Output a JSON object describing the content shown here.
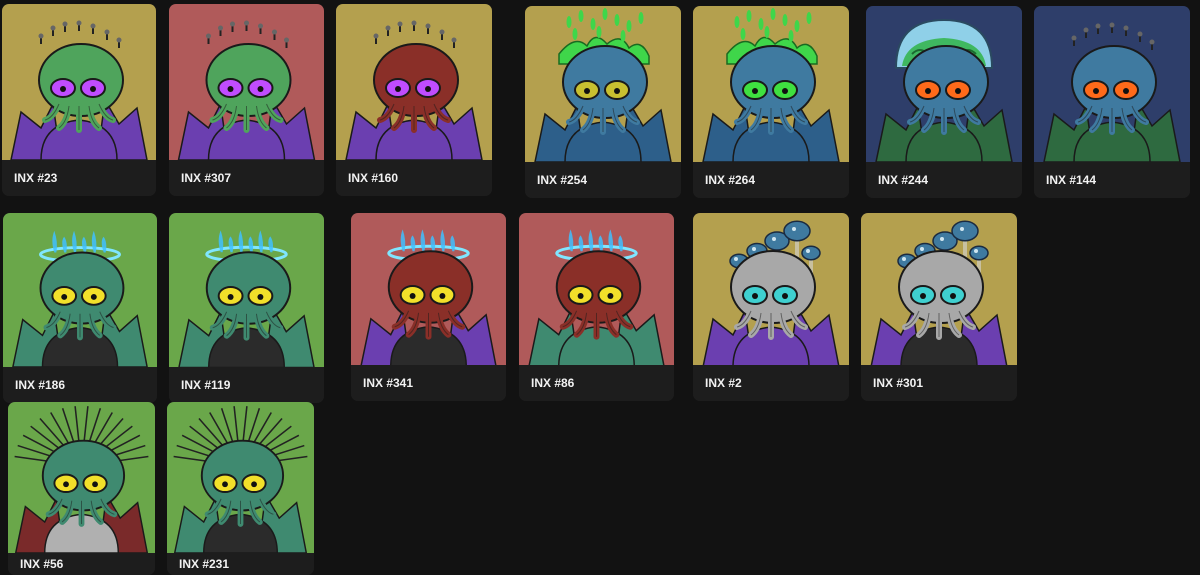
{
  "colors": {
    "page_background": "#121212",
    "caption_background": "#1d1d1d",
    "caption_text": "#f2f2f2",
    "bg_gold": "#b4a04e",
    "bg_red": "#b05a5a",
    "bg_green": "#6aa74a",
    "bg_blue": "#2e3e6a"
  },
  "gallery": {
    "items": [
      {
        "label": "INX #23",
        "background": "gold",
        "skin": "#4fa45c",
        "eyes": "#c04cff",
        "tentacles": "#4fa45c",
        "body": "#6b3fb0",
        "headwear": "spikes",
        "wings": "#6b3fb0"
      },
      {
        "label": "INX #307",
        "background": "red",
        "skin": "#4fa45c",
        "eyes": "#c04cff",
        "tentacles": "#4fa45c",
        "body": "#6b3fb0",
        "headwear": "spikes",
        "wings": "#6b3fb0"
      },
      {
        "label": "INX #160",
        "background": "gold",
        "skin": "#8a2f28",
        "eyes": "#c04cff",
        "tentacles": "#8a2f28",
        "body": "#6b3fb0",
        "headwear": "spikes",
        "wings": "#6b3fb0"
      },
      {
        "label": "INX #254",
        "background": "gold",
        "skin": "#3f7aa0",
        "eyes": "#c8c030",
        "tentacles": "#3f7aa0",
        "body": "#2d5f8a",
        "headwear": "slime",
        "wings": "#2d5f8a"
      },
      {
        "label": "INX #264",
        "background": "gold",
        "skin": "#3f7aa0",
        "eyes": "#3fe040",
        "tentacles": "#3f7aa0",
        "body": "#2d5f8a",
        "headwear": "slime",
        "wings": "#2d5f8a"
      },
      {
        "label": "INX #244",
        "background": "blue",
        "skin": "#3f7aa0",
        "eyes": "#ff6a1a",
        "tentacles": "#3f7aa0",
        "body": "#2e6a40",
        "headwear": "brain",
        "wings": "#2e6a40"
      },
      {
        "label": "INX #144",
        "background": "blue",
        "skin": "#3f7aa0",
        "eyes": "#ff6a1a",
        "tentacles": "#3f7aa0",
        "body": "#2e6a40",
        "headwear": "spikes",
        "wings": "#2e6a40"
      },
      {
        "label": "INX #186",
        "background": "green",
        "skin": "#3f8a70",
        "eyes": "#f2e02a",
        "tentacles": "#3f8a70",
        "body": "#2b2b2b",
        "headwear": "halo",
        "wings": "#3f8a70"
      },
      {
        "label": "INX #119",
        "background": "green",
        "skin": "#3f8a70",
        "eyes": "#f2e02a",
        "tentacles": "#3f8a70",
        "body": "#2b2b2b",
        "headwear": "halo",
        "wings": "#3f8a70"
      },
      {
        "label": "INX #341",
        "background": "red",
        "skin": "#8a2f28",
        "eyes": "#f2e02a",
        "tentacles": "#8a2f28",
        "body": "#2b2b2b",
        "headwear": "halo",
        "wings": "#6b3fb0"
      },
      {
        "label": "INX #86",
        "background": "red",
        "skin": "#8a2f28",
        "eyes": "#f2e02a",
        "tentacles": "#8a2f28",
        "body": "#3f8a70",
        "headwear": "halo",
        "wings": "#3f8a70"
      },
      {
        "label": "INX #2",
        "background": "gold",
        "skin": "#a8a8a8",
        "eyes": "#3fd0d0",
        "tentacles": "#a8a8a8",
        "body": "#6b3fb0",
        "headwear": "mushrooms",
        "wings": "#6b3fb0"
      },
      {
        "label": "INX #301",
        "background": "gold",
        "skin": "#a8a8a8",
        "eyes": "#3fd0d0",
        "tentacles": "#a8a8a8",
        "body": "#2b2b2b",
        "headwear": "mushrooms",
        "wings": "#6b3fb0"
      },
      {
        "label": "INX #56",
        "background": "green",
        "skin": "#3f8a70",
        "eyes": "#f2e02a",
        "tentacles": "#3f8a70",
        "body": "#b0b0b0",
        "headwear": "needles",
        "wings": "#7a2a2a"
      },
      {
        "label": "INX #231",
        "background": "green",
        "skin": "#3f8a70",
        "eyes": "#f2e02a",
        "tentacles": "#3f8a70",
        "body": "#2b2b2b",
        "headwear": "needles",
        "wings": "#3f8a70"
      }
    ]
  }
}
